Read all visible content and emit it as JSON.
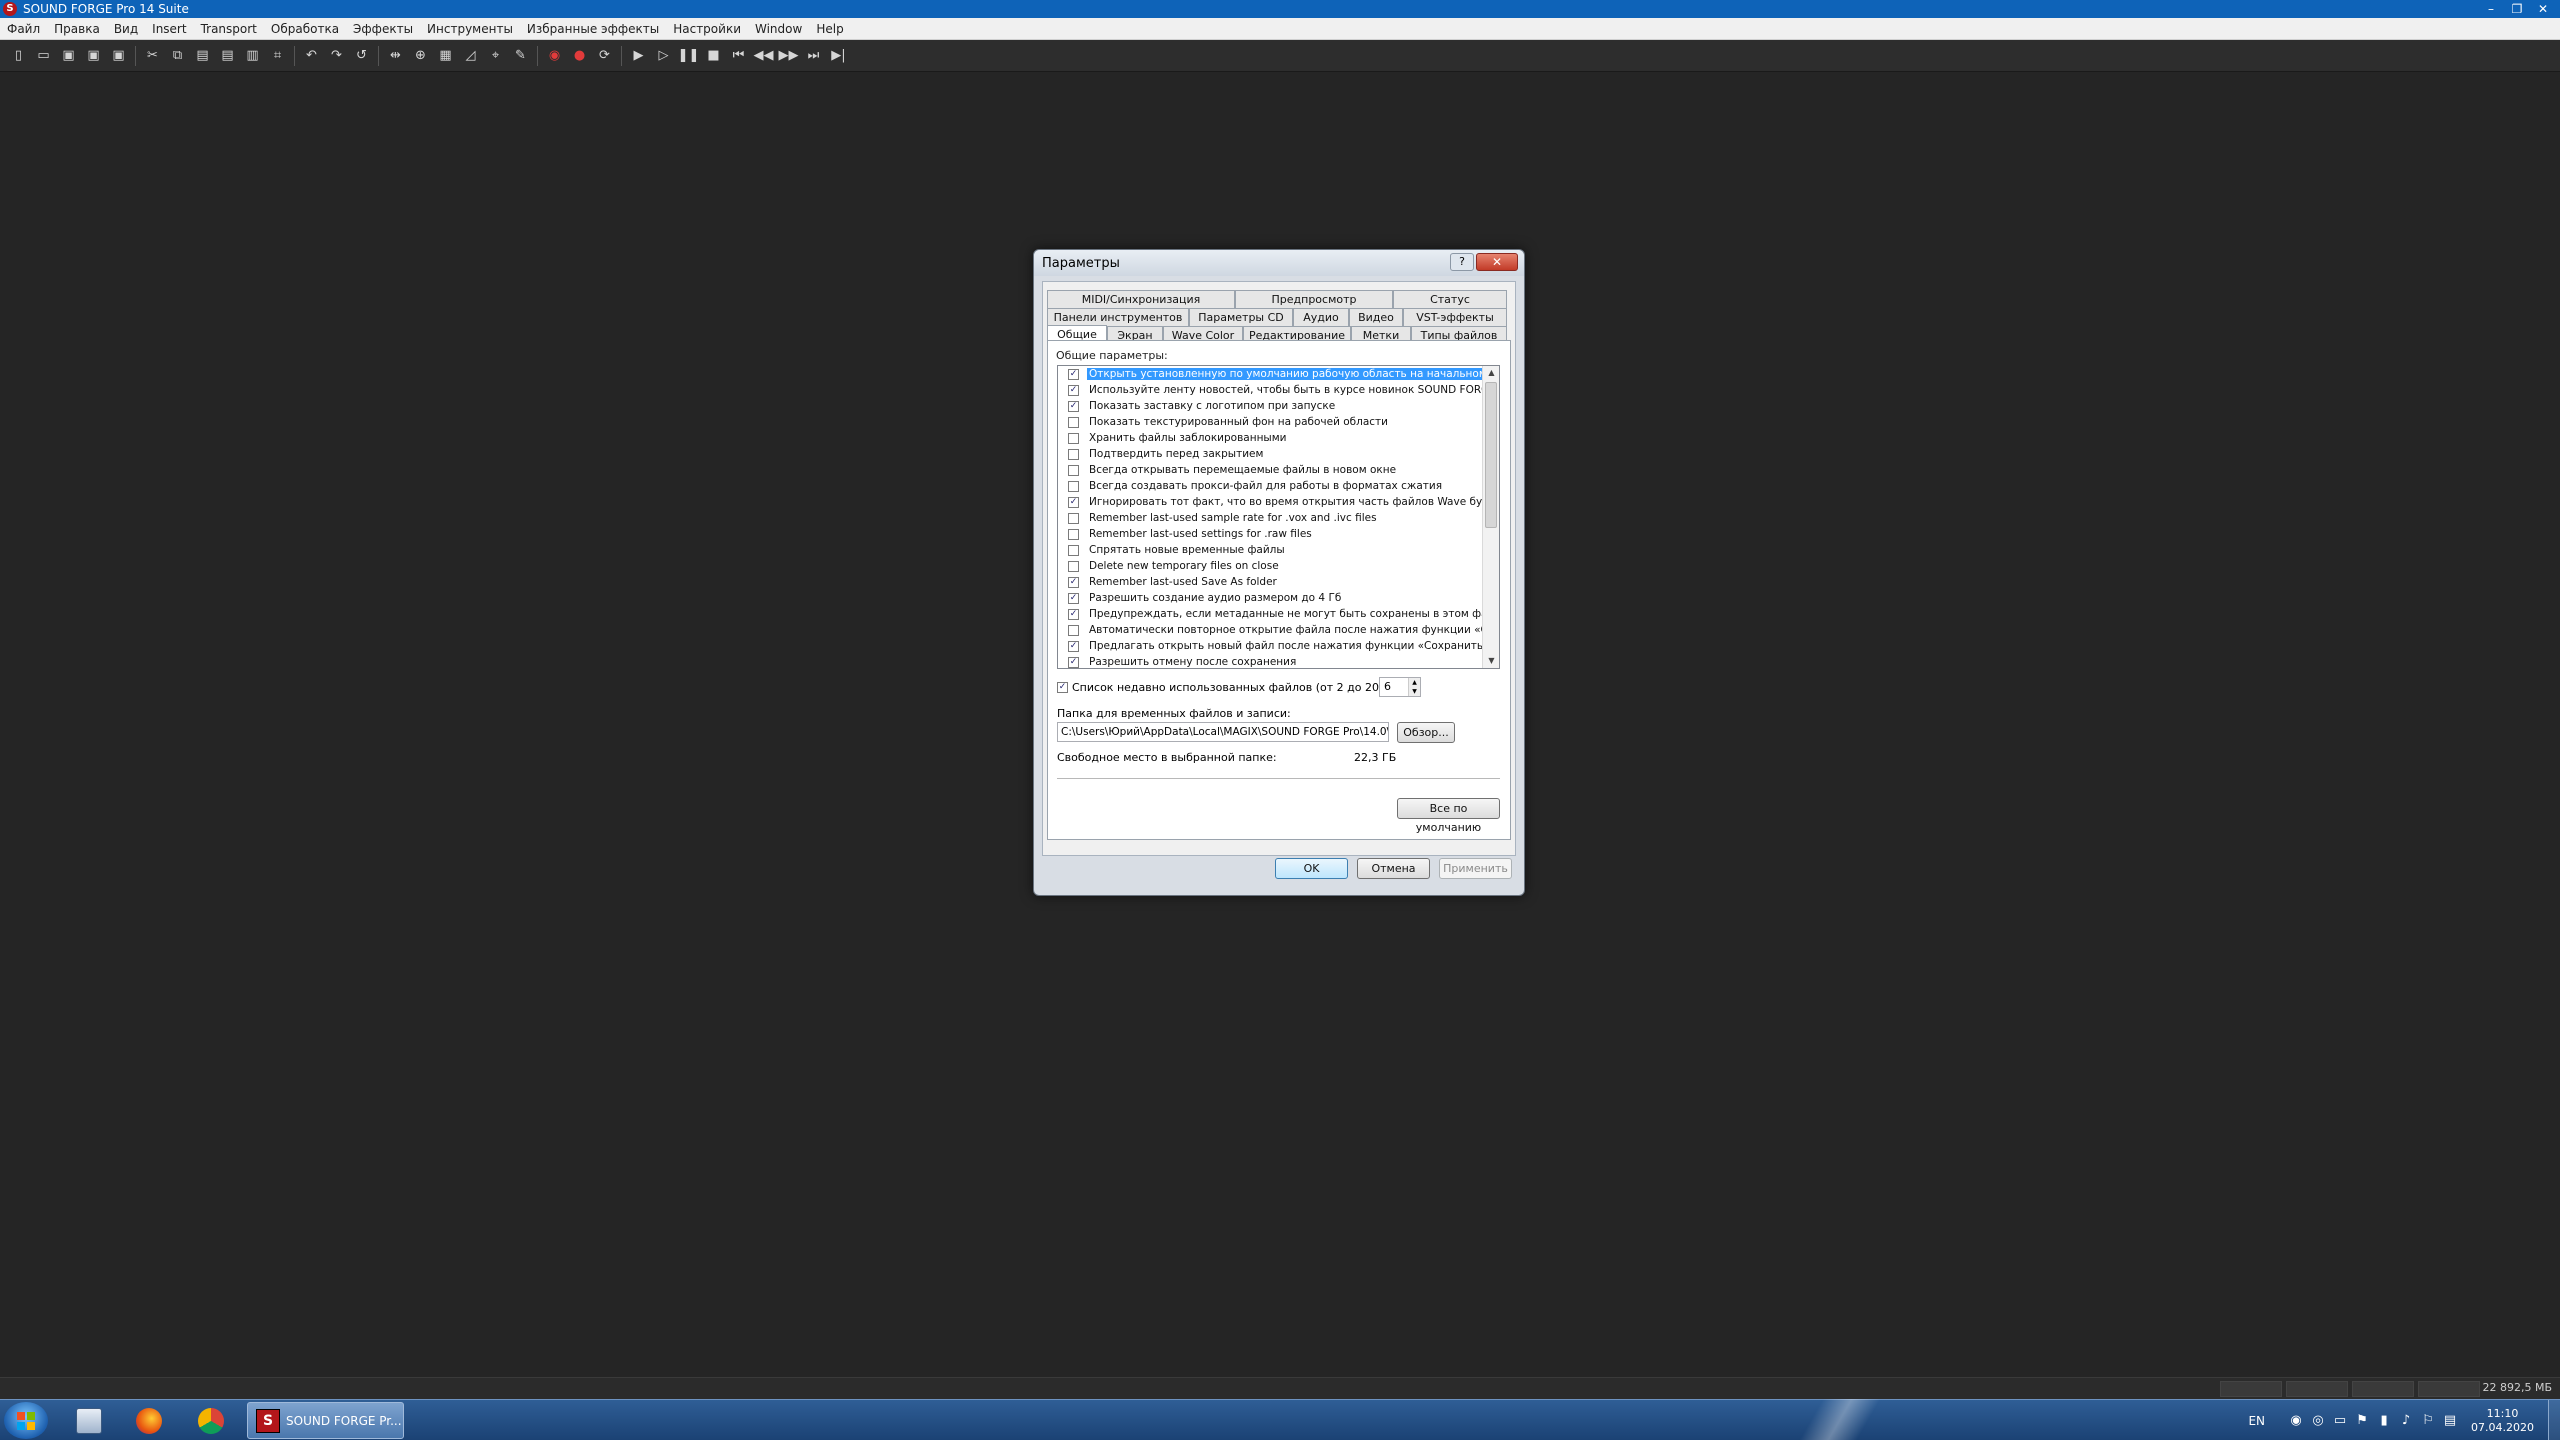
{
  "app": {
    "title": "SOUND FORGE Pro 14 Suite",
    "icon_letter": "S"
  },
  "window_controls": {
    "minimize": "–",
    "restore": "❐",
    "close": "✕"
  },
  "menu": [
    "Файл",
    "Правка",
    "Вид",
    "Insert",
    "Transport",
    "Обработка",
    "Эффекты",
    "Инструменты",
    "Избранные эффекты",
    "Настройки",
    "Window",
    "Help"
  ],
  "toolbar_icons": [
    "new-file-icon",
    "open-folder-icon",
    "save-icon",
    "save-as-icon",
    "save-all-icon",
    "cut-icon",
    "copy-icon",
    "paste-icon",
    "paste-special-icon",
    "mix-icon",
    "crop-icon",
    "undo-icon",
    "redo-icon",
    "repeat-icon",
    "trim-icon",
    "zoom-icon",
    "normalize-icon",
    "fade-icon",
    "marker-icon",
    "edit-tool-icon",
    "record-icon",
    "record-armed-icon",
    "loop-icon",
    "play-all-icon",
    "play-icon",
    "pause-icon",
    "stop-icon",
    "go-start-icon",
    "rewind-icon",
    "forward-icon",
    "go-end-icon",
    "next-icon"
  ],
  "dialog": {
    "title": "Параметры",
    "help": "?",
    "close": "✕",
    "tabs_row1": [
      "MIDI/Синхронизация",
      "Предпросмотр",
      "Статус"
    ],
    "tabs_row2": [
      "Панели инструментов",
      "Параметры CD",
      "Аудио",
      "Видео",
      "VST-эффекты"
    ],
    "tabs_row3": [
      "Общие",
      "Экран",
      "Wave Color",
      "Редактирование",
      "Метки",
      "Типы файлов"
    ],
    "active_tab": "Общие",
    "section_label": "Общие параметры:",
    "options": [
      {
        "label": "Открыть установленную по умолчанию рабочую область на начальном эта",
        "checked": true,
        "selected": true
      },
      {
        "label": "Используйте ленту новостей, чтобы быть в курсе новинок SOUND FORGE",
        "checked": true
      },
      {
        "label": "Показать заставку с логотипом при запуске",
        "checked": true
      },
      {
        "label": "Показать текстурированный фон на рабочей области",
        "checked": false
      },
      {
        "label": "Хранить файлы заблокированными",
        "checked": false
      },
      {
        "label": "Подтвердить перед закрытием",
        "checked": false
      },
      {
        "label": "Всегда открывать перемещаемые файлы в новом окне",
        "checked": false
      },
      {
        "label": "Всегда создавать прокси-файл для работы в форматах сжатия",
        "checked": false
      },
      {
        "label": "Игнорировать тот факт, что  во время открытия часть  файлов Wave будет",
        "checked": true
      },
      {
        "label": "Remember last-used sample rate for .vox and .ivc files",
        "checked": false
      },
      {
        "label": "Remember last-used settings for .raw files",
        "checked": false
      },
      {
        "label": "Спрятать новые временные файлы",
        "checked": false
      },
      {
        "label": "Delete new temporary files on close",
        "checked": false
      },
      {
        "label": "Remember last-used Save As folder",
        "checked": true
      },
      {
        "label": "Разрешить создание аудио размером до 4 Гб",
        "checked": true
      },
      {
        "label": "Предупреждать, если метаданные не могут быть сохранены в этом файле",
        "checked": true
      },
      {
        "label": "Автоматически повторное открытие файла после нажатия функции «Сохра",
        "checked": false
      },
      {
        "label": "Предлагать открыть новый файл после нажатия функции «Сохранить как»",
        "checked": true
      },
      {
        "label": "Разрешить отмену после сохранения",
        "checked": true
      }
    ],
    "recent_files_label": "Список недавно использованных файлов (от 2 до 20):",
    "recent_files_checked": true,
    "recent_files_value": "6",
    "temp_folder_label": "Папка для временных файлов и записи:",
    "temp_folder_value": "C:\\Users\\Юрий\\AppData\\Local\\MAGIX\\SOUND FORGE Pro\\14.0\\",
    "browse_button": "Обзор...",
    "free_space_label": "Свободное место в выбранной папке:",
    "free_space_value": "22,3 ГБ",
    "defaults_button": "Все по умолчанию",
    "ok_button": "OK",
    "cancel_button": "Отмена",
    "apply_button": "Применить"
  },
  "statusbar": {
    "memory": "22 892,5 МБ"
  },
  "taskbar": {
    "active_task": "SOUND FORGE Pr...",
    "language": "EN",
    "time": "11:10",
    "date": "07.04.2020"
  },
  "colors": {
    "workspace": "#252525",
    "titlebar": "#0e63b8",
    "selection": "#3399ff",
    "taskbar": "#1b4274"
  }
}
